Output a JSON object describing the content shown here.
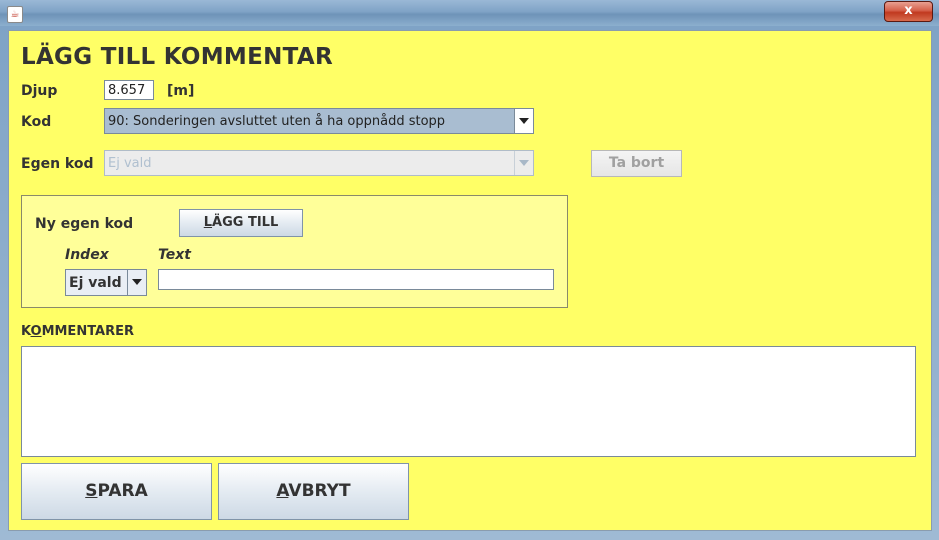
{
  "window": {
    "close_label": "x"
  },
  "heading": "LÄGG TILL KOMMENTAR",
  "djup": {
    "label": "Djup",
    "value": "8.657",
    "unit": "[m]"
  },
  "kod": {
    "label": "Kod",
    "selected": "90: Sonderingen avsluttet uten å ha oppnådd stopp"
  },
  "egen_kod": {
    "label": "Egen kod",
    "selected": "Ej vald",
    "remove_label": "Ta bort"
  },
  "ny_egen_kod": {
    "label": "Ny egen kod",
    "add_first": "L",
    "add_rest": "ÄGG TILL",
    "index_label": "Index",
    "text_label": "Text",
    "index_selected": "Ej vald",
    "text_value": ""
  },
  "kommentarer": {
    "label_k": "K",
    "label_o": "O",
    "label_rest": "MMENTARER",
    "value": ""
  },
  "buttons": {
    "spara_first": "S",
    "spara_rest": "PARA",
    "avbryt_first": "A",
    "avbryt_rest": "VBRYT"
  },
  "colors": {
    "panel_bg": "#ffff66",
    "kod_selected_bg": "#a9bdd1"
  }
}
